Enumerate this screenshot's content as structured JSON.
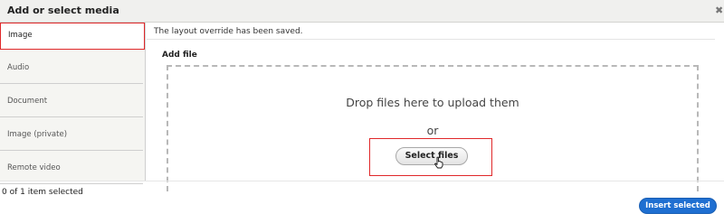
{
  "dialog": {
    "title": "Add or select media",
    "close_label": "✖"
  },
  "sidebar": {
    "items": [
      {
        "label": "Image",
        "active": true
      },
      {
        "label": "Audio",
        "active": false
      },
      {
        "label": "Document",
        "active": false
      },
      {
        "label": "Image (private)",
        "active": false
      },
      {
        "label": "Remote video",
        "active": false
      }
    ]
  },
  "main": {
    "status_message": "The layout override has been saved.",
    "add_file_label": "Add file",
    "drop_text": "Drop files here to upload them",
    "or_text": "or",
    "select_files_label": "Select files"
  },
  "footer": {
    "selection_count": "0 of 1 item selected",
    "insert_button_label": "Insert selected"
  },
  "colors": {
    "highlight_red": "#e0282a",
    "primary_blue": "#1f6fd1"
  }
}
